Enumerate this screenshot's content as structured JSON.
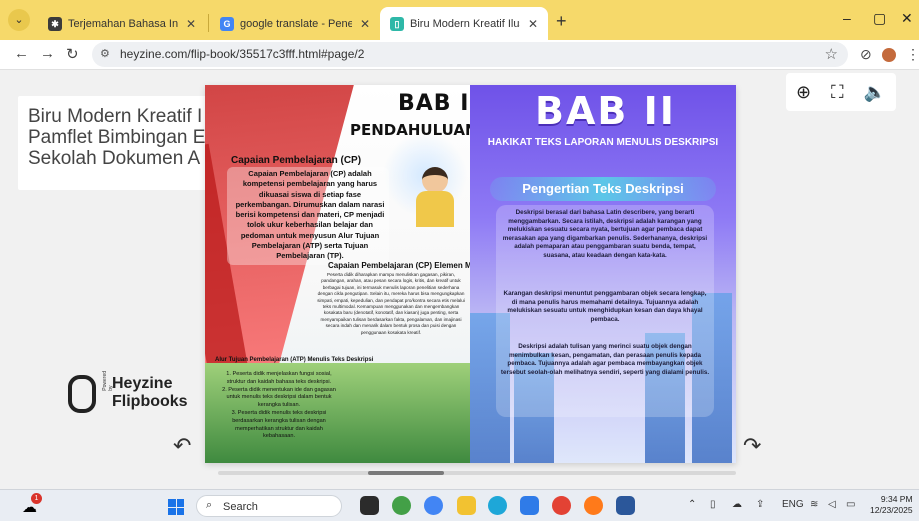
{
  "browser": {
    "tabs": [
      {
        "title": "Terjemahan Bahasa Indonesia",
        "active": false,
        "favicon_color": "#3b3b3b"
      },
      {
        "title": "google translate - Penelusuran",
        "active": false,
        "favicon_color": "#4285f4"
      },
      {
        "title": "Biru Modern Kreatif Ilustrasi Pa",
        "active": true,
        "favicon_color": "#2eb8a8"
      }
    ],
    "new_tab_icon": "plus-icon",
    "window_controls": {
      "minimize": "–",
      "maximize": "▢",
      "close": "✕"
    },
    "address": "heyzine.com/flip-book/35517c3fff.html#page/2"
  },
  "page": {
    "doc_title_lines": [
      "Biru Modern Kreatif I",
      "Pamflet Bimbingan E",
      "Sekolah Dokumen A"
    ],
    "logo": {
      "powered": "Powered by",
      "line1": "Heyzine",
      "line2": "Flipbooks"
    },
    "viewer_tools": [
      "zoom-in-icon",
      "fullscreen-icon",
      "volume-icon"
    ]
  },
  "book": {
    "left": {
      "chapter": "BAB I",
      "title": "PENDAHULUAN",
      "cp_heading": "Capaian Pembelajaran (CP)",
      "cp_text": "Capaian Pembelajaran (CP) adalah kompetensi pembelajaran yang harus dikuasai siswa di setiap fase perkembangan. Dirumuskan dalam narasi berisi kompetensi dan materi, CP menjadi tolok ukur keberhasilan belajar dan pedoman untuk menyusun Alur Tujuan Pembelajaran (ATP) serta Tujuan Pembelajaran (TP).",
      "ecp_heading": "Capaian Pembelajaran (CP) Elemen Menulis",
      "ecp_text": "Peserta didik diharapkan mampu menuliskan gagasan, pikiran, pandangan, arahan, atau pesan secara logis, kritis, dan kreatif untuk berbagai tujuan, ini termasuk menulis laporan penelitian sederhana dengan cikla pengutipan. Selain itu, mereka harus bisa mengungkapkan simpati, empati, kepedulian, dan pendapat pro/kontra secara etis melalui teks multimodal. Kemampuan menggunakan dan mengembangkan kosakata baru (denotatif, konotatif, dan kiasan) juga penting, serta menyampaikan tulisan berdasarkan fakta, pengalaman, dan imajinasi secara indah dan menarik dalam bentuk prosa dan puisi dengan penggunaan kosakata kreatif.",
      "tp_heading": "Alur Tujuan Pembelajaran (ATP) Menulis Teks Deskripsi",
      "tp_items": [
        "1. Peserta didik menjelaskan fungsi sosial, struktur dan kaidah bahasa teks deskripsi.",
        "2. Peserta didik menentukan ide dan gagasan untuk menulis teks deskripsi dalam bentuk kerangka tulisan.",
        "3. Peserta didik menulis teks deskripsi berdasarkan kerangka tulisan dengan memperhatikan struktur dan kaidah kebahasaan."
      ]
    },
    "right": {
      "chapter": "BAB II",
      "subtitle": "HAKIKAT TEKS LAPORAN MENULIS DESKRIPSI",
      "section": "Pengertian Teks Deskripsi",
      "p1": "Deskripsi berasal dari bahasa Latin describere, yang berarti menggambarkan. Secara istilah, deskripsi adalah karangan yang melukiskan sesuatu secara nyata, bertujuan agar pembaca dapat merasakan apa yang digambarkan penulis. Sederhananya, deskripsi adalah pemaparan atau penggambaran suatu benda, tempat, suasana, atau keadaan dengan kata-kata.",
      "p2": "Karangan deskripsi menuntut penggambaran objek secara lengkap, di mana penulis harus memahami detailnya. Tujuannya adalah melukiskan sesuatu untuk menghidupkan kesan dan daya khayal pembaca.",
      "p3": "Deskripsi adalah tulisan yang merinci suatu objek dengan menimbulkan kesan, pengamatan, dan perasaan penulis kepada pembaca. Tujuannya adalah agar pembaca membayangkan objek tersebut seolah-olah melihatnya sendiri, seperti yang dialami penulis."
    }
  },
  "taskbar": {
    "weather_badge": "1",
    "search_placeholder": "Search",
    "lang": "ENG",
    "time": "9:34 PM",
    "date": "12/23/2025"
  },
  "colors": {
    "tabstrip": "#f6d96a",
    "bab2_page_top": "#6f52e8",
    "bab1_accent": "#c21b1b"
  }
}
